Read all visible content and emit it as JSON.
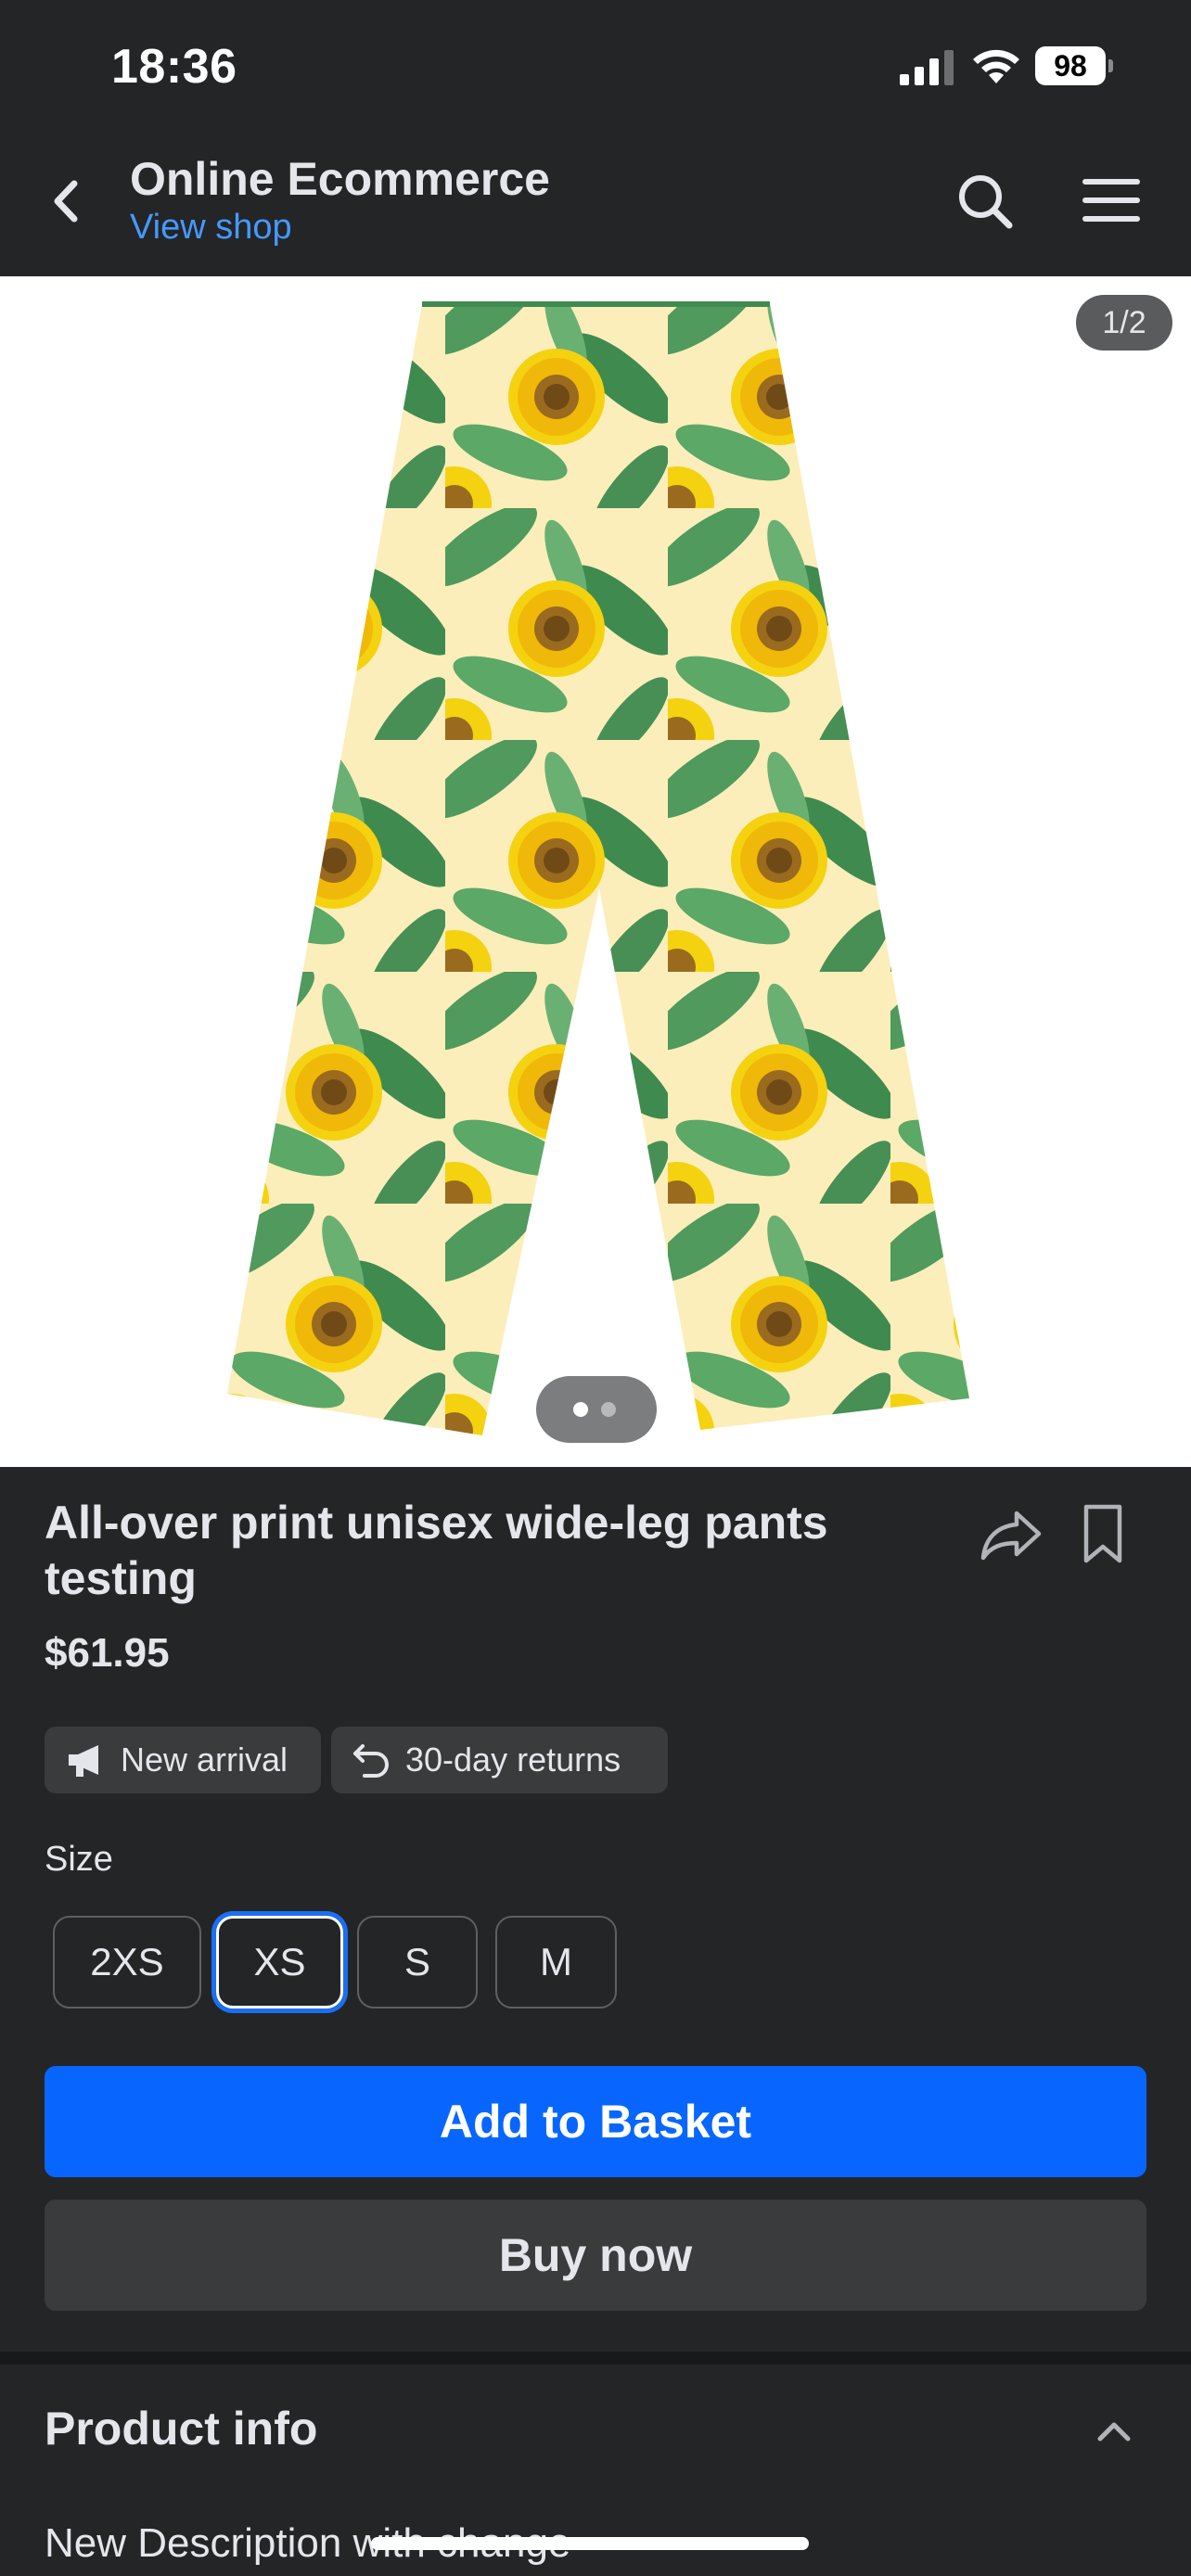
{
  "status_bar": {
    "time": "18:36",
    "battery": "98",
    "signal_icon": "cellular-signal-icon",
    "wifi_icon": "wifi-icon"
  },
  "header": {
    "title": "Online Ecommerce",
    "subtitle_link": "View shop",
    "back_icon": "chevron-left-icon",
    "search_icon": "search-icon",
    "menu_icon": "hamburger-menu-icon"
  },
  "gallery": {
    "counter": "1/2",
    "current_index": 1,
    "total_images": 2,
    "image_subject": "Sunflower print wide-leg pants"
  },
  "product": {
    "title": "All-over print unisex wide-leg pants testing",
    "price": "$61.95",
    "share_icon": "share-icon",
    "save_icon": "bookmark-icon",
    "badges": [
      {
        "label": "New arrival",
        "icon": "megaphone-icon"
      },
      {
        "label": "30-day returns",
        "icon": "return-arrow-icon"
      }
    ]
  },
  "size_selector": {
    "label": "Size",
    "options": [
      "2XS",
      "XS",
      "S",
      "M"
    ],
    "selected": "XS"
  },
  "actions": {
    "add_to_basket": "Add to Basket",
    "buy_now": "Buy now"
  },
  "product_info": {
    "title": "Product info",
    "description": "New Description with change",
    "collapse_icon": "chevron-up-icon"
  },
  "colors": {
    "background": "#242526",
    "primary_button": "#0866ff",
    "link": "#4599ff",
    "selected_outline": "#1a6ff2"
  }
}
